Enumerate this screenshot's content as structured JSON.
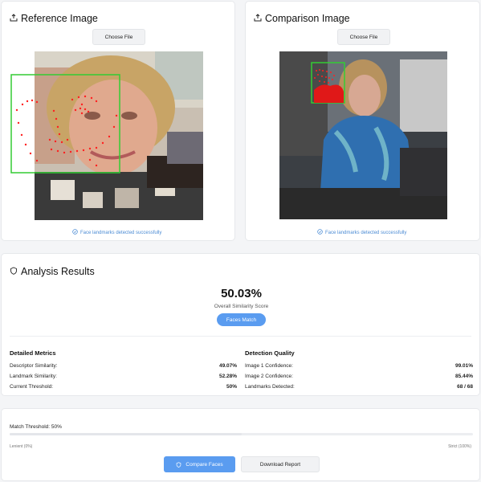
{
  "reference": {
    "title": "Reference Image",
    "choose_label": "Choose File",
    "status": "Face landmarks detected successfully"
  },
  "comparison": {
    "title": "Comparison Image",
    "choose_label": "Choose File",
    "status": "Face landmarks detected successfully"
  },
  "analysis": {
    "title": "Analysis Results",
    "score": "50.03%",
    "score_label": "Overall Similarity Score",
    "match_badge": "Faces Match",
    "metrics_title": "Detailed Metrics",
    "metrics": [
      {
        "label": "Descriptor Similarity:",
        "value": "49.07%"
      },
      {
        "label": "Landmark Similarity:",
        "value": "52.28%"
      },
      {
        "label": "Current Threshold:",
        "value": "50%"
      }
    ],
    "quality_title": "Detection Quality",
    "quality": [
      {
        "label": "Image 1 Confidence:",
        "value": "99.01%"
      },
      {
        "label": "Image 2 Confidence:",
        "value": "85.44%"
      },
      {
        "label": "Landmarks Detected:",
        "value": "68 / 68"
      }
    ]
  },
  "threshold": {
    "label": "Match Threshold: 50%",
    "value_fraction": 0.5,
    "min_label": "Lenient (0%)",
    "max_label": "Strict (100%)"
  },
  "actions": {
    "compare_label": "Compare Faces",
    "download_label": "Download Report"
  },
  "colors": {
    "accent": "#5a9cf0",
    "landmark": "#ff2020",
    "box": "#33cc33",
    "status": "#4b8bd4"
  }
}
